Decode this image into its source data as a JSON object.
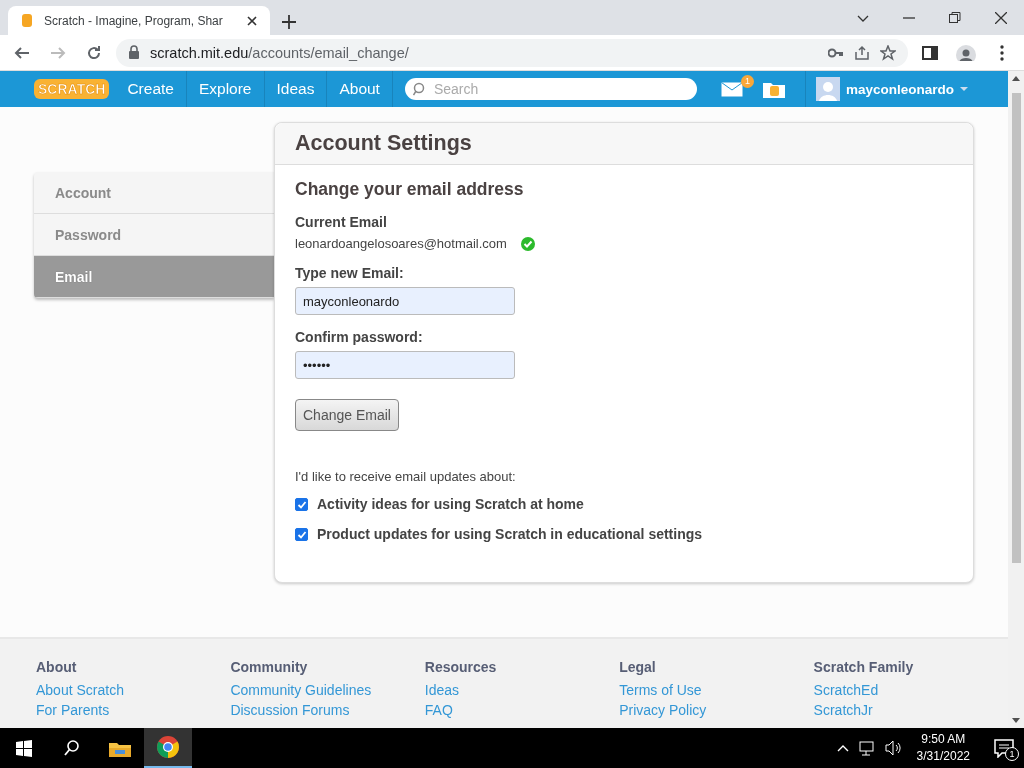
{
  "browser": {
    "tab_title": "Scratch - Imagine, Program, Shar",
    "url_host": "scratch.mit.edu",
    "url_path": "/accounts/email_change/"
  },
  "nav": {
    "logo": "SCRATCH",
    "items": [
      "Create",
      "Explore",
      "Ideas",
      "About"
    ],
    "search": {
      "placeholder": "Search"
    },
    "messages_count": "1",
    "username": "mayconleonardo"
  },
  "sidebar": {
    "items": [
      {
        "label": "Account",
        "selected": false
      },
      {
        "label": "Password",
        "selected": false
      },
      {
        "label": "Email",
        "selected": true
      }
    ]
  },
  "settings": {
    "title": "Account Settings",
    "heading": "Change your email address",
    "current_email_label": "Current Email",
    "current_email": "leonardoangelosoares@hotmail.com",
    "verified": true,
    "fields": [
      {
        "label": "Type new Email:",
        "value": "mayconleonardo"
      },
      {
        "label": "Confirm password:",
        "value": "••••••"
      }
    ],
    "button": "Change Email",
    "updates_intro": "I'd like to receive email updates about:",
    "options": [
      {
        "label": "Activity ideas for using Scratch at home",
        "checked": true
      },
      {
        "label": "Product updates for using Scratch in educational settings",
        "checked": true
      }
    ]
  },
  "footer": {
    "columns": [
      {
        "title": "About",
        "links": [
          "About Scratch",
          "For Parents"
        ]
      },
      {
        "title": "Community",
        "links": [
          "Community Guidelines",
          "Discussion Forums"
        ]
      },
      {
        "title": "Resources",
        "links": [
          "Ideas",
          "FAQ"
        ]
      },
      {
        "title": "Legal",
        "links": [
          "Terms of Use",
          "Privacy Policy"
        ]
      },
      {
        "title": "Scratch Family",
        "links": [
          "ScratchEd",
          "ScratchJr"
        ]
      }
    ]
  },
  "taskbar": {
    "time": "9:50 AM",
    "date": "3/31/2022",
    "notifications": "1"
  }
}
